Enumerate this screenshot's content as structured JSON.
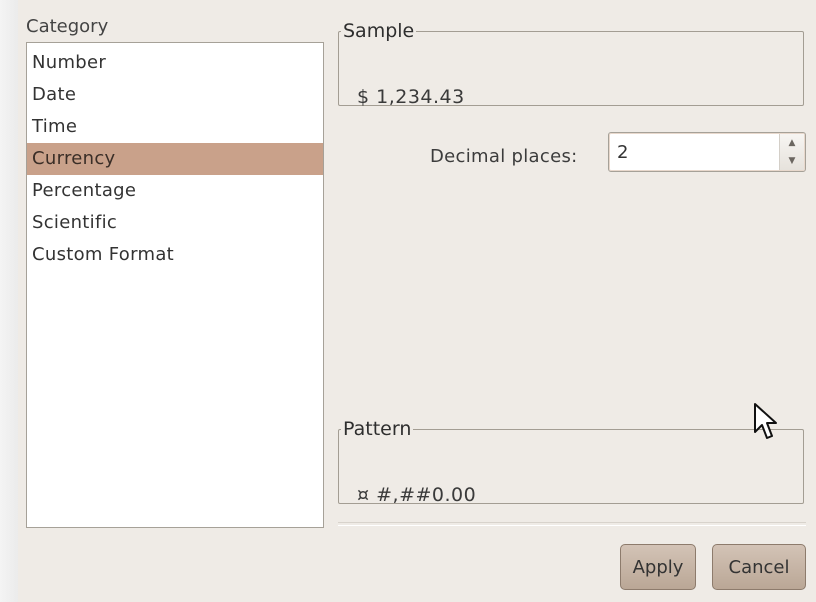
{
  "category": {
    "label": "Category",
    "items": [
      "Number",
      "Date",
      "Time",
      "Currency",
      "Percentage",
      "Scientific",
      "Custom Format"
    ],
    "selected": "Currency"
  },
  "sample": {
    "legend": "Sample",
    "value": "$ 1,234.43"
  },
  "decimal_places": {
    "label": "Decimal places:",
    "value": "2"
  },
  "pattern": {
    "legend": "Pattern",
    "value": "¤ #,##0.00"
  },
  "buttons": {
    "apply": "Apply",
    "cancel": "Cancel"
  },
  "colors": {
    "selected_row": "#c9a18a",
    "dialog_bg": "#efebe6",
    "button": "#c8b6a7"
  }
}
